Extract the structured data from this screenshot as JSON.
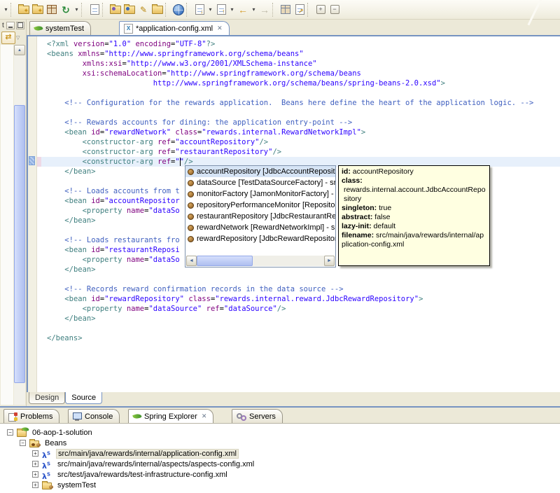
{
  "colors": {
    "chrome_bg": "#ece9d8",
    "active_border_blue": "#7693c1",
    "current_line_highlight": "#e7f0fb",
    "tooltip_bg": "#ffffe1",
    "syntax_tag": "#3f7f7f",
    "syntax_attr": "#7f007f",
    "syntax_value": "#2a00ff",
    "syntax_comment": "#3f5fbf"
  },
  "toolbar": {
    "items": [
      {
        "kind": "caret",
        "name": "toolbar-overflow-caret"
      },
      {
        "kind": "sep"
      },
      {
        "kind": "wizard-folder",
        "name": "new-wizard-icon"
      },
      {
        "kind": "wizard-folder",
        "name": "new-wizard-2-icon"
      },
      {
        "kind": "grid-brown",
        "name": "junit-icon"
      },
      {
        "kind": "refresh",
        "name": "refresh-icon"
      },
      {
        "kind": "caret",
        "name": "refresh-caret"
      },
      {
        "kind": "sep"
      },
      {
        "kind": "page-blue",
        "name": "open-type-icon"
      },
      {
        "kind": "sep"
      },
      {
        "kind": "folder-purple",
        "name": "open-resource-icon"
      },
      {
        "kind": "folder-blue",
        "name": "search-folder-icon"
      },
      {
        "kind": "pen",
        "name": "highlighter-icon"
      },
      {
        "kind": "folder",
        "name": "open-folder-icon"
      },
      {
        "kind": "sep"
      },
      {
        "kind": "globe",
        "name": "web-browser-icon"
      },
      {
        "kind": "sep"
      },
      {
        "kind": "page-down-arrow",
        "name": "last-edit-location-icon"
      },
      {
        "kind": "caret",
        "name": "last-edit-caret"
      },
      {
        "kind": "page-up-arrow",
        "name": "go-into-icon"
      },
      {
        "kind": "caret",
        "name": "go-into-caret"
      },
      {
        "kind": "back-arrow",
        "name": "back-icon"
      },
      {
        "kind": "caret",
        "name": "back-caret"
      },
      {
        "kind": "forward-arrow",
        "name": "forward-icon",
        "disabled": true
      },
      {
        "kind": "sep"
      },
      {
        "kind": "grid-gray",
        "name": "table-icon"
      },
      {
        "kind": "page-arrow",
        "name": "next-annotation-icon"
      },
      {
        "kind": "sep"
      },
      {
        "kind": "plus-box",
        "name": "expand-all-icon"
      },
      {
        "kind": "minus-box",
        "name": "collapse-all-icon"
      }
    ]
  },
  "left_panel": {
    "tab_stub": "t",
    "link_glyph": "⇄",
    "menu_glyph": "▽",
    "scroll_up_glyph": "▲"
  },
  "editor": {
    "tabs": [
      {
        "label": "systemTest",
        "icon": "spring-leaf-icon",
        "active": false,
        "closable": false
      },
      {
        "label": "*application-config.xml",
        "icon": "xml-file-icon",
        "active": true,
        "closable": true
      }
    ],
    "close_glyph": "✕",
    "code_lines": [
      "<?xml version=\"1.0\" encoding=\"UTF-8\"?>",
      "<beans xmlns=\"http://www.springframework.org/schema/beans\"",
      "        xmlns:xsi=\"http://www.w3.org/2001/XMLSchema-instance\"",
      "        xsi:schemaLocation=\"http://www.springframework.org/schema/beans",
      "                        http://www.springframework.org/schema/beans/spring-beans-2.0.xsd\">",
      "",
      "    <!-- Configuration for the rewards application.  Beans here define the heart of the application logic. -->",
      "",
      "    <!-- Rewards accounts for dining: the application entry-point -->",
      "    <bean id=\"rewardNetwork\" class=\"rewards.internal.RewardNetworkImpl\">",
      "        <constructor-arg ref=\"accountRepository\"/>",
      "        <constructor-arg ref=\"restaurantRepository\"/>",
      "        <constructor-arg ref=\"\"/>",
      "    </bean>",
      "",
      "    <!-- Loads accounts from t",
      "    <bean id=\"accountRepositor",
      "        <property name=\"dataSo",
      "    </bean>",
      "",
      "    <!-- Loads restaurants fro",
      "    <bean id=\"restaurantReposi",
      "        <property name=\"dataSo",
      "    </bean>",
      "",
      "    <!-- Records reward confirmation records in the data source -->",
      "    <bean id=\"rewardRepository\" class=\"rewards.internal.reward.JdbcRewardRepository\">",
      "        <property name=\"dataSource\" ref=\"dataSource\"/>",
      "    </bean>",
      "",
      "</beans>"
    ],
    "current_line_index": 12,
    "cursor_ch": 30,
    "bottom_tabs": [
      {
        "label": "Design",
        "active": false
      },
      {
        "label": "Source",
        "active": true
      }
    ]
  },
  "content_assist": {
    "items": [
      {
        "label": "accountRepository [JdbcAccountRepository] - src",
        "selected": true
      },
      {
        "label": "dataSource [TestDataSourceFactory] - src/test/ja",
        "selected": false
      },
      {
        "label": "monitorFactory [JamonMonitorFactory] - src/main",
        "selected": false
      },
      {
        "label": "repositoryPerformanceMonitor [RepositoryPerform",
        "selected": false
      },
      {
        "label": "restaurantRepository [JdbcRestaurantRepository",
        "selected": false
      },
      {
        "label": "rewardNetwork [RewardNetworkImpl] - src/main/j",
        "selected": false
      },
      {
        "label": "rewardRepository [JdbcRewardRepository] - src/r",
        "selected": false
      }
    ],
    "scroll_left_glyph": "◄",
    "scroll_right_glyph": "►"
  },
  "bean_tooltip": {
    "fields": [
      {
        "label": "id:",
        "value": "accountRepository",
        "inline": true
      },
      {
        "label": "class:",
        "value": "rewards.internal.account.JdbcAccountRepository",
        "inline": false
      },
      {
        "label": "singleton:",
        "value": "true",
        "inline": true
      },
      {
        "label": "abstract:",
        "value": "false",
        "inline": true
      },
      {
        "label": "lazy-init:",
        "value": "default",
        "inline": true
      },
      {
        "label": "filename:",
        "value": "src/main/java/rewards/internal/application-config.xml",
        "inline": true
      }
    ]
  },
  "bottom_panel": {
    "tabs": [
      {
        "label": "Problems",
        "icon": "problems-icon",
        "active": false,
        "closable": false
      },
      {
        "label": "Console",
        "icon": "console-icon",
        "active": false,
        "closable": false
      },
      {
        "label": "Spring Explorer",
        "icon": "spring-leaf-icon",
        "active": true,
        "closable": true
      },
      {
        "label": "Servers",
        "icon": "servers-icon",
        "active": false,
        "closable": false
      }
    ],
    "tree": [
      {
        "label": "06-aop-1-solution",
        "depth": 0,
        "expander": "minus",
        "icon": "spring-project-icon",
        "selected": false
      },
      {
        "label": "Beans",
        "depth": 1,
        "expander": "minus",
        "icon": "beans-folder-icon",
        "selected": false
      },
      {
        "label": "src/main/java/rewards/internal/application-config.xml",
        "depth": 2,
        "expander": "plus",
        "icon": "spring-config-icon",
        "selected": true
      },
      {
        "label": "src/main/java/rewards/internal/aspects/aspects-config.xml",
        "depth": 2,
        "expander": "plus",
        "icon": "spring-config-icon",
        "selected": false
      },
      {
        "label": "src/test/java/rewards/test-infrastructure-config.xml",
        "depth": 2,
        "expander": "plus",
        "icon": "spring-config-icon",
        "selected": false
      },
      {
        "label": "systemTest",
        "depth": 2,
        "expander": "plus",
        "icon": "bean-folder-icon",
        "selected": false
      }
    ]
  }
}
